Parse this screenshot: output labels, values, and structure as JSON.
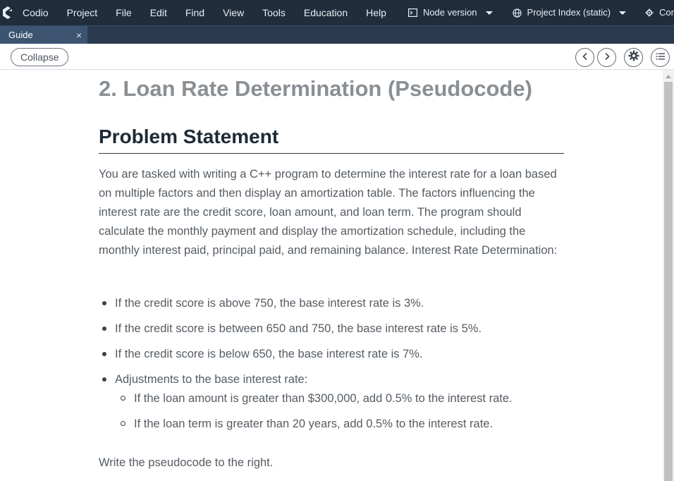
{
  "menubar": {
    "items": [
      "Codio",
      "Project",
      "File",
      "Edit",
      "Find",
      "View",
      "Tools",
      "Education",
      "Help"
    ],
    "node_version": "Node version",
    "project_index": "Project Index (static)",
    "truncated_item": "Cor"
  },
  "tabs": [
    {
      "label": "Guide",
      "close": "×"
    }
  ],
  "toolbar": {
    "collapse_label": "Collapse"
  },
  "guide": {
    "title": "2. Loan Rate Determination (Pseudocode)",
    "section_heading": "Problem Statement",
    "paragraph": "You are tasked with writing a C++ program to determine the interest rate for a loan based on multiple factors and then display an amortization table. The factors influencing the interest rate are the credit score, loan amount, and loan term. The program should calculate the monthly payment and display the amortization schedule, including the monthly interest paid, principal paid, and remaining balance. Interest Rate Determination:",
    "bullets": [
      "If the credit score is above 750, the base interest rate is 3%.",
      "If the credit score is between 650 and 750, the base interest rate is 5%.",
      "If the credit score is below 650, the base interest rate is 7%.",
      "Adjustments to the base interest rate:"
    ],
    "sub_bullets": [
      "If the loan amount is greater than $300,000, add 0.5% to the interest rate.",
      "If the loan term is greater than 20 years, add 0.5% to the interest rate."
    ],
    "closing": "Write the pseudocode to the right."
  },
  "colors": {
    "menubar_bg": "#1f2d3d",
    "tabbar_bg": "#2a3a4f",
    "active_tab_bg": "#3c5470",
    "heading_gray": "#8a8f94",
    "body_text": "#555c63"
  }
}
